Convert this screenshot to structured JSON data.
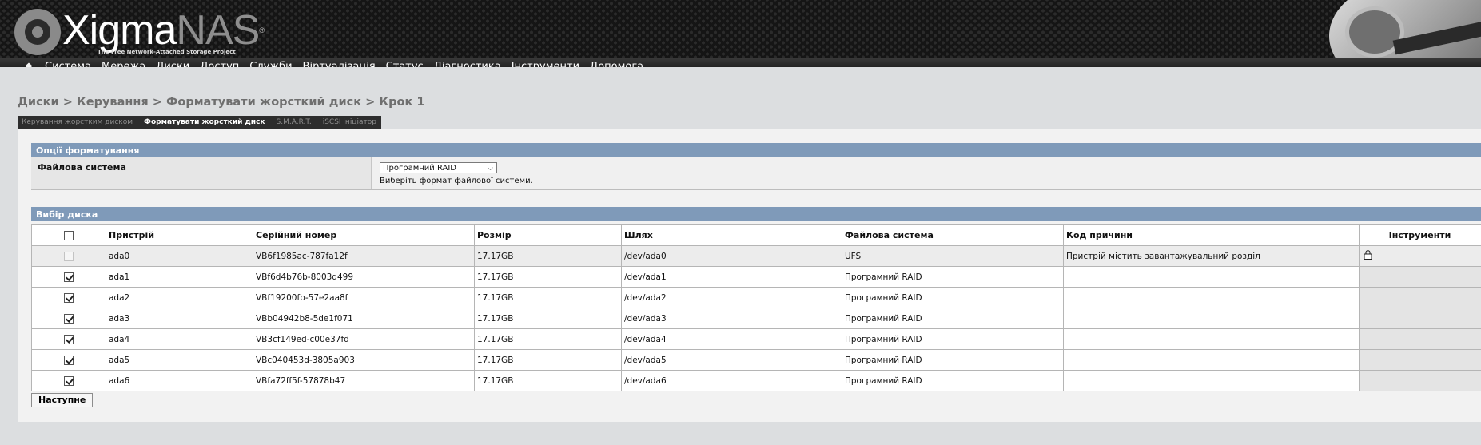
{
  "header": {
    "logo_word_light": "Xigma",
    "logo_word_dark": "NAS",
    "logo_reg": "®",
    "logo_tagline": "The Free Network-Attached Storage Project"
  },
  "nav": {
    "home_icon": "home-icon",
    "items": [
      "Система",
      "Мережа",
      "Диски",
      "Доступ",
      "Служби",
      "Віртуалізація",
      "Статус",
      "Діагностика",
      "Інструменти",
      "Допомога"
    ]
  },
  "breadcrumb": "Диски > Керування > Форматувати жорсткий диск > Крок 1",
  "tabs": [
    "Керування жорстким диском",
    "Форматувати жорсткий диск",
    "S.M.A.R.T.",
    "iSCSI ініціатор"
  ],
  "format_options": {
    "title": "Опції форматування",
    "fs_label": "Файлова система",
    "fs_selected": "Програмний RAID",
    "fs_hint": "Виберіть формат файлової системи."
  },
  "disk_selection": {
    "title": "Вибір диска",
    "columns": [
      "Пристрій",
      "Серійний номер",
      "Розмір",
      "Шлях",
      "Файлова система",
      "Код причини",
      "Інструменти"
    ],
    "rows": [
      {
        "device": "ada0",
        "serial": "VB6f1985ac-787fa12f",
        "size": "17.17GB",
        "path": "/dev/ada0",
        "fs": "UFS",
        "reason": "Пристрій містить завантажувальний розділ",
        "checked": false,
        "disabled": true,
        "tool_icon": "lock-icon"
      },
      {
        "device": "ada1",
        "serial": "VBf6d4b76b-8003d499",
        "size": "17.17GB",
        "path": "/dev/ada1",
        "fs": "Програмний RAID",
        "reason": "",
        "checked": true,
        "disabled": false
      },
      {
        "device": "ada2",
        "serial": "VBf19200fb-57e2aa8f",
        "size": "17.17GB",
        "path": "/dev/ada2",
        "fs": "Програмний RAID",
        "reason": "",
        "checked": true,
        "disabled": false
      },
      {
        "device": "ada3",
        "serial": "VBb04942b8-5de1f071",
        "size": "17.17GB",
        "path": "/dev/ada3",
        "fs": "Програмний RAID",
        "reason": "",
        "checked": true,
        "disabled": false
      },
      {
        "device": "ada4",
        "serial": "VB3cf149ed-c00e37fd",
        "size": "17.17GB",
        "path": "/dev/ada4",
        "fs": "Програмний RAID",
        "reason": "",
        "checked": true,
        "disabled": false
      },
      {
        "device": "ada5",
        "serial": "VBc040453d-3805a903",
        "size": "17.17GB",
        "path": "/dev/ada5",
        "fs": "Програмний RAID",
        "reason": "",
        "checked": true,
        "disabled": false
      },
      {
        "device": "ada6",
        "serial": "VBfa72ff5f-57878b47",
        "size": "17.17GB",
        "path": "/dev/ada6",
        "fs": "Програмний RAID",
        "reason": "",
        "checked": true,
        "disabled": false
      }
    ]
  },
  "next_button": "Наступне"
}
